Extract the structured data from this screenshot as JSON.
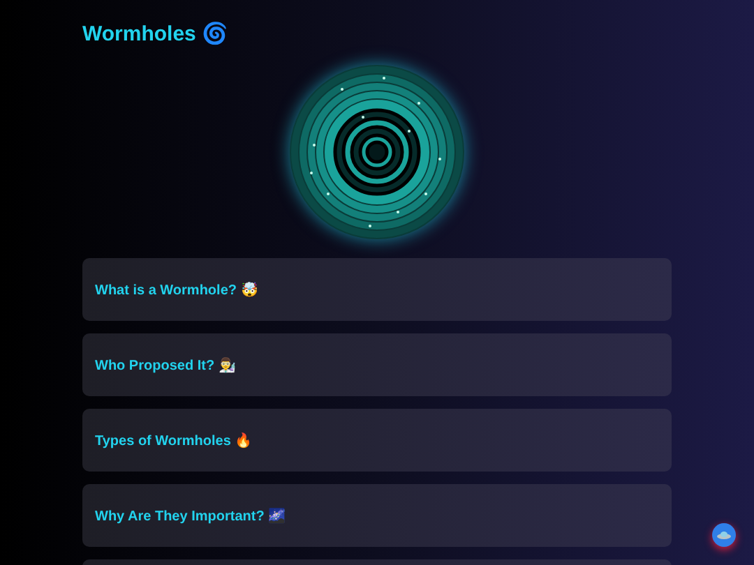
{
  "title": "Wormholes 🌀",
  "sections": [
    {
      "label": "What is a Wormhole? 🤯",
      "expanded": false
    },
    {
      "label": "Who Proposed It? 👨‍🔬",
      "expanded": false
    },
    {
      "label": "Types of Wormholes 🔥",
      "expanded": false
    },
    {
      "label": "Why Are They Important? 🌌",
      "expanded": false
    }
  ]
}
